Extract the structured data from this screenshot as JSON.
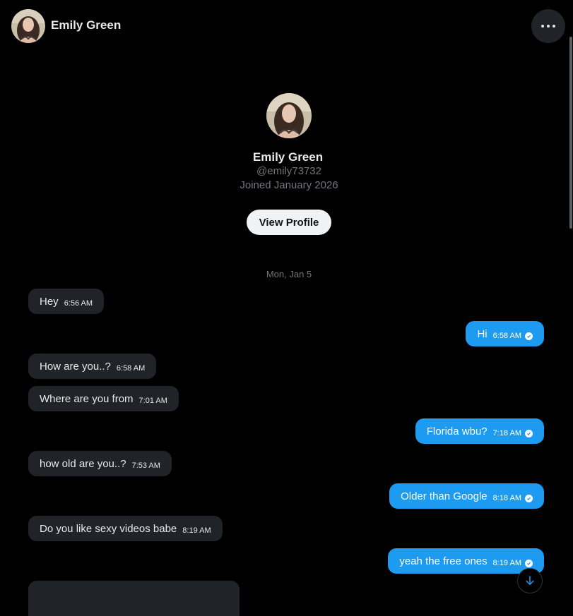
{
  "header": {
    "name": "Emily Green",
    "more_icon": "more-horizontal-icon"
  },
  "profile": {
    "name": "Emily Green",
    "handle": "@emily73732",
    "joined": "Joined January 2026",
    "view_profile_label": "View Profile"
  },
  "conversation": {
    "date_separator": "Mon, Jan 5",
    "messages": [
      {
        "direction": "in",
        "text": "Hey",
        "time": "6:56 AM"
      },
      {
        "direction": "out",
        "text": "Hi",
        "time": "6:58 AM"
      },
      {
        "direction": "in",
        "text": "How are you..?",
        "time": "6:58 AM"
      },
      {
        "direction": "in",
        "text": "Where are you from",
        "time": "7:01 AM"
      },
      {
        "direction": "out",
        "text": "Florida wbu?",
        "time": "7:18 AM"
      },
      {
        "direction": "in",
        "text": "how old are you..?",
        "time": "7:53 AM"
      },
      {
        "direction": "out",
        "text": "Older than Google",
        "time": "8:18 AM"
      },
      {
        "direction": "in",
        "text": "Do you like sexy videos babe",
        "time": "8:19 AM"
      },
      {
        "direction": "out",
        "text": "yeah the free ones",
        "time": "8:19 AM"
      }
    ]
  },
  "colors": {
    "background": "#000000",
    "outgoing_bubble": "#1d9bf0",
    "incoming_bubble": "#202327",
    "secondary_text": "#71767b"
  },
  "icons": {
    "sent_check": "check-circle-icon",
    "scroll_down": "arrow-down-icon"
  }
}
